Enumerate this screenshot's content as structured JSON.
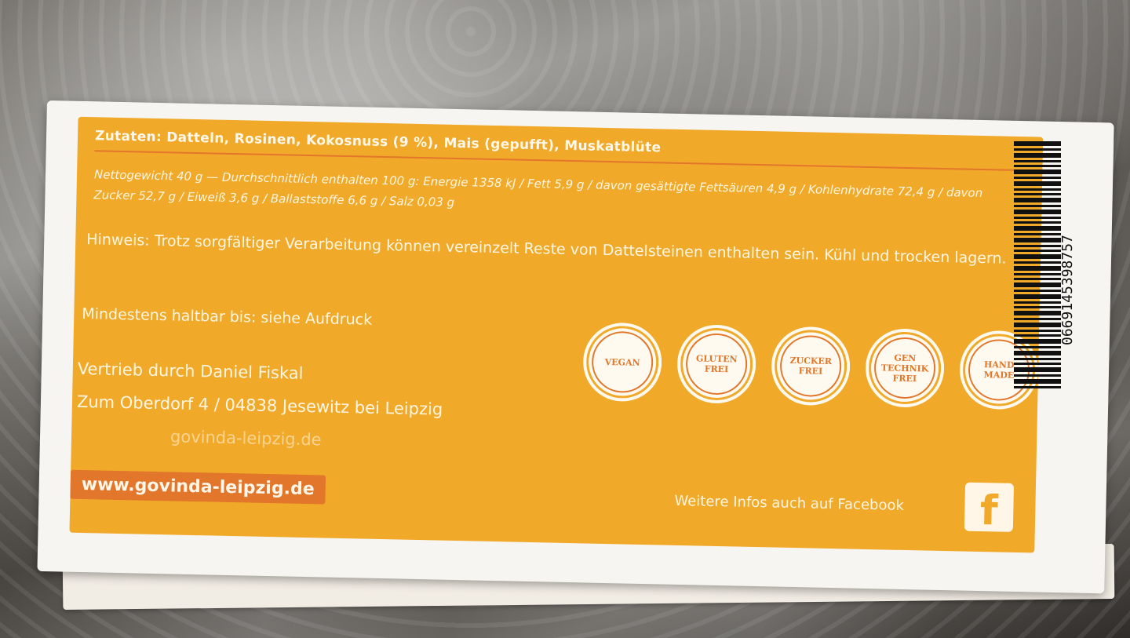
{
  "ingredients": "Zutaten: Datteln, Rosinen, Kokosnuss (9 %), Mais (gepufft), Muskatblüte",
  "nutrition": "Nettogewicht 40 g — Durchschnittlich enthalten 100 g: Energie 1358 kJ / Fett 5,9 g / davon gesättigte Fettsäuren 4,9 g / Kohlenhydrate 72,4 g / davon Zucker 52,7 g / Eiweiß 3,6 g / Ballaststoffe 6,6 g / Salz 0,03 g",
  "hint": "Hinweis: Trotz sorgfältiger Verarbeitung können vereinzelt Reste von Dattelsteinen enthalten sein. Kühl und trocken lagern.",
  "best_before": "Mindestens haltbar bis: siehe Aufdruck",
  "distributor": {
    "line1": "Vertrieb durch Daniel Fiskal",
    "line2": "Zum Oberdorf 4 / 04838 Jesewitz bei Leipzig",
    "email_partial": "govinda-leipzig.de"
  },
  "website": "www.govinda-leipzig.de",
  "facebook_text": "Weitere Infos auch auf Facebook",
  "facebook_icon": "facebook-icon",
  "badges": [
    {
      "label": "VEGAN"
    },
    {
      "label": "GLUTEN\nFREI"
    },
    {
      "label": "ZUCKER\nFREI"
    },
    {
      "label": "GEN\nTECHNIK\nFREI"
    },
    {
      "label": "HAND\nMADE"
    }
  ],
  "barcode_number": "0669145398757",
  "colors": {
    "label_orange": "#f1a92a",
    "accent_orange": "#e2762a",
    "text_cream": "#fff6e2"
  }
}
